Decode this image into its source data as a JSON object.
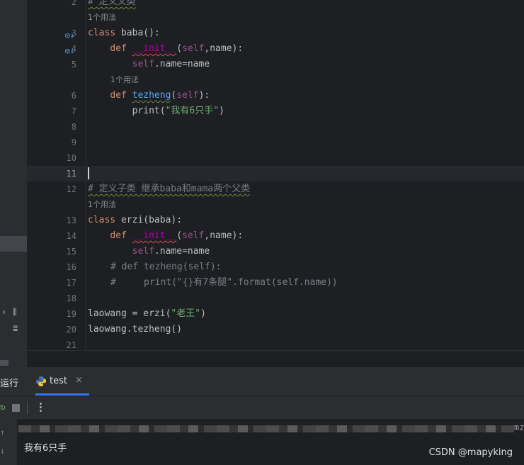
{
  "editor": {
    "current_line": "11",
    "lines": [
      {
        "num": "2",
        "hint": null
      },
      {
        "num": "3"
      },
      {
        "num": "4"
      },
      {
        "num": "5"
      },
      {
        "num": "6"
      },
      {
        "num": "7"
      },
      {
        "num": "8"
      },
      {
        "num": "9"
      },
      {
        "num": "10"
      },
      {
        "num": "11"
      },
      {
        "num": "12"
      },
      {
        "num": "13"
      },
      {
        "num": "14"
      },
      {
        "num": "15"
      },
      {
        "num": "16"
      },
      {
        "num": "17"
      },
      {
        "num": "18"
      },
      {
        "num": "19"
      },
      {
        "num": "20"
      },
      {
        "num": "21"
      }
    ],
    "usage_hint": "1个用法",
    "code": {
      "l2": "# 定义父类",
      "l3_kw": "class",
      "l3_name": " baba():",
      "l4_kw": "def",
      "l4_fn": "__init__",
      "l4_paren": "(",
      "l4_self": "self",
      "l4_rest": ",name):",
      "l5_self": "self",
      "l5_rest": ".name=name",
      "l6_kw": "def",
      "l6_fn": "tezheng",
      "l6_paren": "(",
      "l6_self": "self",
      "l6_rest": "):",
      "l7_a": "print(",
      "l7_str": "\"我有6只手\"",
      "l7_b": ")",
      "l12": "# 定义子类 继承baba和mama两个父类",
      "l13_kw": "class",
      "l13_name": " erzi(baba):",
      "l14_kw": "def",
      "l14_fn": "__init__",
      "l14_paren": "(",
      "l14_self": "self",
      "l14_rest": ",name):",
      "l15_self": "self",
      "l15_rest": ".name=name",
      "l16": "# def tezheng(self):",
      "l17": "#     print(\"{}有7条腿\".format(self.name))",
      "l19_a": "laowang = erzi(",
      "l19_str": "\"老王\"",
      "l19_b": ")",
      "l20": "laowang.tezheng()"
    }
  },
  "run_panel": {
    "label": "运行",
    "tab_name": "test",
    "close_glyph": "×",
    "more_glyph": "⋮",
    "console_tail": "mzi",
    "output": "我有6只手"
  },
  "watermark": "CSDN @mapyking",
  "colors": {
    "accent": "#3574f0",
    "keyword": "#cf8e6d",
    "function": "#56a8f5",
    "string": "#6aab73",
    "comment": "#7a7e85"
  }
}
